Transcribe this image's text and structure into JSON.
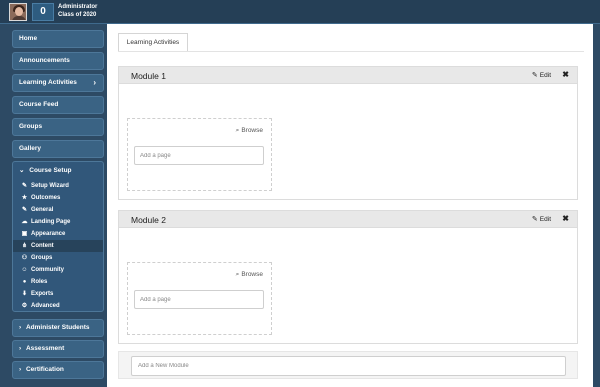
{
  "header": {
    "count": "0",
    "user_role": "Administrator",
    "user_class": "Class of 2020"
  },
  "sidebar": {
    "items": [
      {
        "label": "Home"
      },
      {
        "label": "Announcements"
      },
      {
        "label": "Learning Activities",
        "chevron": "›"
      },
      {
        "label": "Course Feed"
      },
      {
        "label": "Groups"
      },
      {
        "label": "Gallery"
      }
    ],
    "course_setup": {
      "label": "Course Setup",
      "chevron": "⌄",
      "items": [
        {
          "label": "Setup Wizard",
          "icon": "magic-wand-icon",
          "glyph": "✎"
        },
        {
          "label": "Outcomes",
          "icon": "star-icon",
          "glyph": "★"
        },
        {
          "label": "General",
          "icon": "edit-icon",
          "glyph": "✎"
        },
        {
          "label": "Landing Page",
          "icon": "cloud-icon",
          "glyph": "☁"
        },
        {
          "label": "Appearance",
          "icon": "image-icon",
          "glyph": "▣"
        },
        {
          "label": "Content",
          "icon": "sitemap-icon",
          "glyph": "⋔"
        },
        {
          "label": "Groups",
          "icon": "users-icon",
          "glyph": "⚇"
        },
        {
          "label": "Community",
          "icon": "smile-icon",
          "glyph": "☺"
        },
        {
          "label": "Roles",
          "icon": "user-icon",
          "glyph": "●"
        },
        {
          "label": "Exports",
          "icon": "download-icon",
          "glyph": "⬇"
        },
        {
          "label": "Advanced",
          "icon": "cogs-icon",
          "glyph": "⚙"
        }
      ]
    },
    "bottom_items": [
      {
        "label": "Administer Students",
        "chevron": "›"
      },
      {
        "label": "Assessment",
        "chevron": "›"
      },
      {
        "label": "Certification",
        "chevron": "›"
      }
    ]
  },
  "main": {
    "tab_label": "Learning Activities",
    "modules": [
      {
        "title": "Module 1",
        "edit_label": "Edit",
        "close_glyph": "✖",
        "browse_label": "Browse",
        "page_placeholder": "Add a page"
      },
      {
        "title": "Module 2",
        "edit_label": "Edit",
        "close_glyph": "✖",
        "browse_label": "Browse",
        "page_placeholder": "Add a page"
      }
    ],
    "new_module_placeholder": "Add a New Module"
  },
  "colors": {
    "sidebar_bg": "#2d4a64",
    "nav_item_bg": "#3a6384",
    "active_item_bg": "#27435b"
  }
}
